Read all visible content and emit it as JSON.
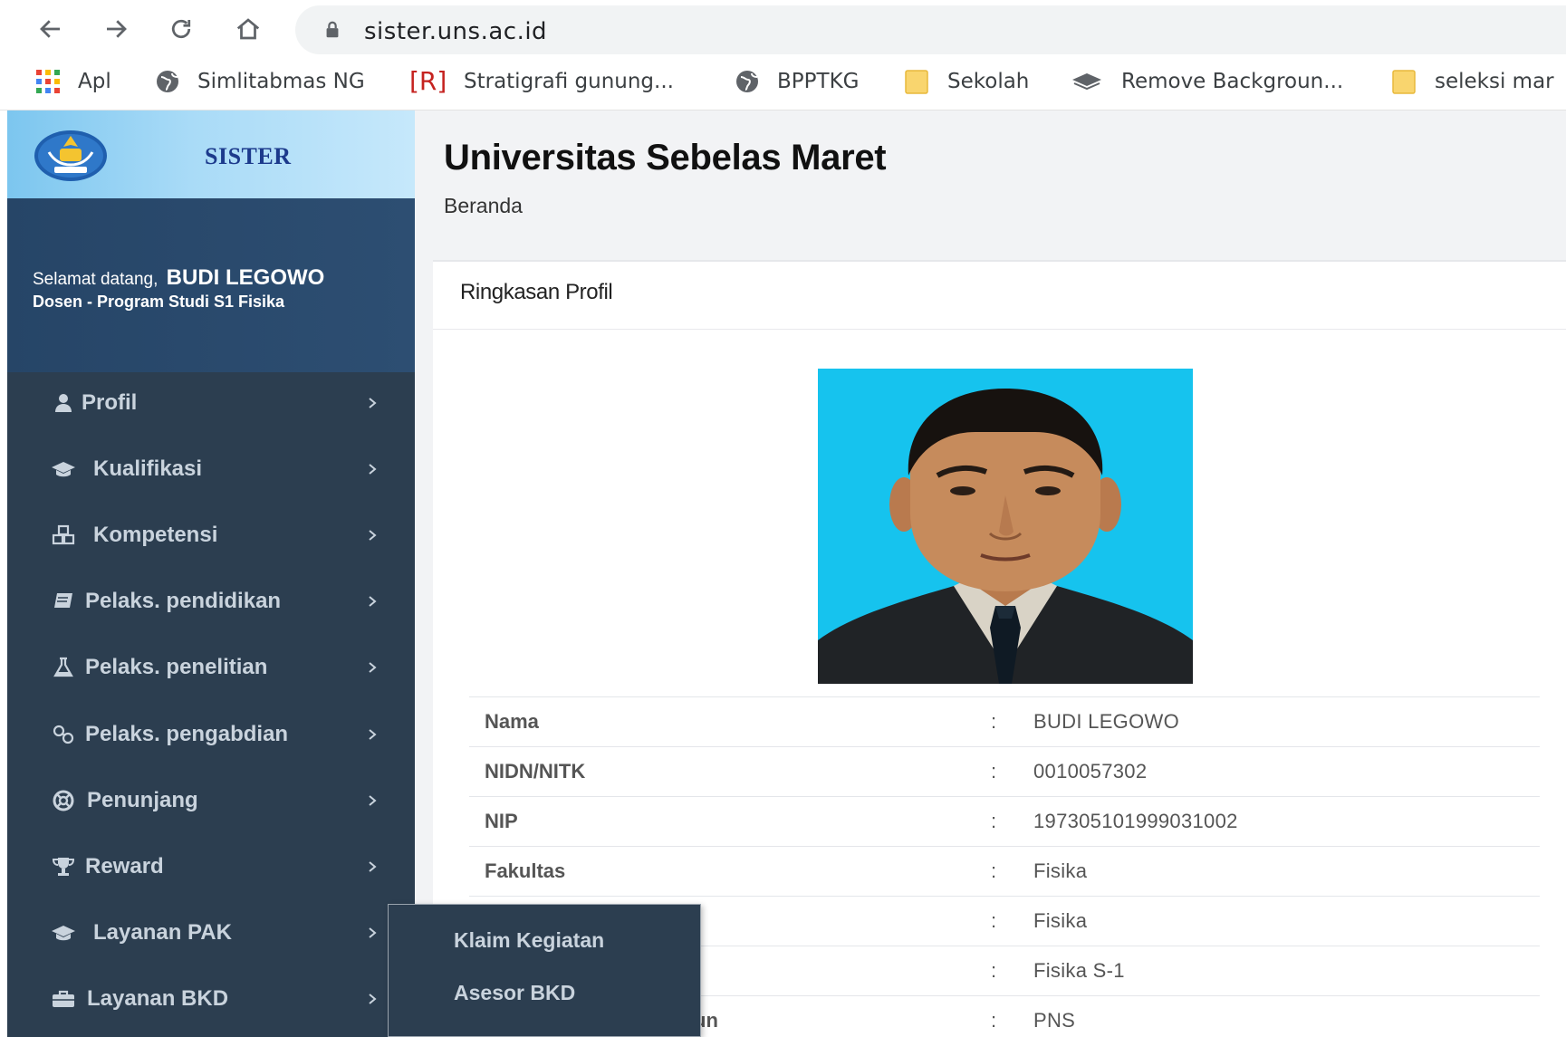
{
  "browser": {
    "url": "sister.uns.ac.id",
    "bookmarks": [
      {
        "label": "Apl",
        "icon": "apps-grid-icon"
      },
      {
        "label": "Simlitabmas NG",
        "icon": "globe-icon"
      },
      {
        "label": "Stratigrafi gunung...",
        "icon": "r-bracket-icon",
        "icon_text": "[R]"
      },
      {
        "label": "BPPTKG",
        "icon": "globe-icon"
      },
      {
        "label": "Sekolah",
        "icon": "folder-icon"
      },
      {
        "label": "Remove Backgroun...",
        "icon": "layers-icon"
      },
      {
        "label": "seleksi mar",
        "icon": "folder-icon"
      }
    ]
  },
  "sidebar": {
    "brand": "SISTER",
    "welcome_prefix": "Selamat datang,",
    "user_name": "BUDI LEGOWO",
    "user_role": "Dosen - Program Studi S1 Fisika",
    "items": [
      {
        "label": "Profil",
        "icon": "user-icon"
      },
      {
        "label": "Kualifikasi",
        "icon": "graduation-cap-icon"
      },
      {
        "label": "Kompetensi",
        "icon": "cubes-icon"
      },
      {
        "label": "Pelaks. pendidikan",
        "icon": "book-icon"
      },
      {
        "label": "Pelaks. penelitian",
        "icon": "flask-icon"
      },
      {
        "label": "Pelaks. pengabdian",
        "icon": "link-icon"
      },
      {
        "label": "Penunjang",
        "icon": "life-ring-icon"
      },
      {
        "label": "Reward",
        "icon": "trophy-icon"
      },
      {
        "label": "Layanan PAK",
        "icon": "graduation-cap-icon"
      },
      {
        "label": "Layanan BKD",
        "icon": "briefcase-icon"
      }
    ],
    "flyout": [
      "Klaim Kegiatan",
      "Asesor BKD"
    ]
  },
  "main": {
    "title": "Universitas Sebelas Maret",
    "breadcrumb": "Beranda",
    "card_title": "Ringkasan Profil",
    "rows": [
      {
        "key": "Nama",
        "sep": ":",
        "value": "BUDI LEGOWO"
      },
      {
        "key": "NIDN/NITK",
        "sep": ":",
        "value": "0010057302"
      },
      {
        "key": "NIP",
        "sep": ":",
        "value": "197305101999031002"
      },
      {
        "key": "Fakultas",
        "sep": ":",
        "value": "Fisika"
      },
      {
        "key": "",
        "sep": ":",
        "value": "Fisika"
      },
      {
        "key": "",
        "sep": ":",
        "value": "Fisika S-1"
      },
      {
        "key": "un",
        "sep": ":",
        "value": "PNS"
      }
    ]
  },
  "colors": {
    "sidebar_bg": "#2c3e50",
    "brand_text": "#1c3a8c",
    "photo_bg": "#16c3ee"
  }
}
